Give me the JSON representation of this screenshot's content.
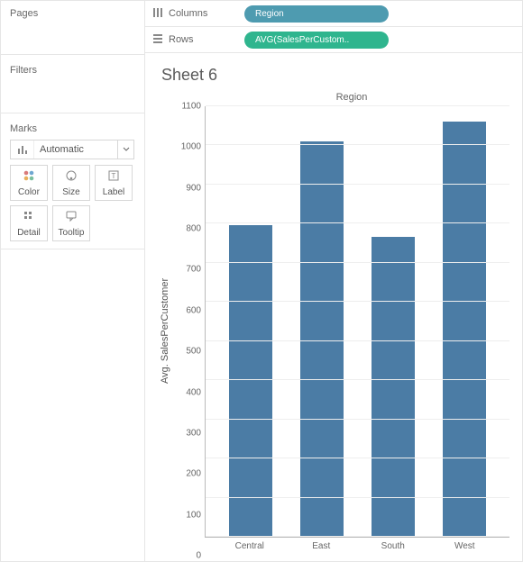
{
  "left": {
    "pages_title": "Pages",
    "filters_title": "Filters",
    "marks_title": "Marks",
    "dropdown_label": "Automatic",
    "mark_buttons": {
      "color": "Color",
      "size": "Size",
      "label": "Label",
      "detail": "Detail",
      "tooltip": "Tooltip"
    }
  },
  "shelves": {
    "columns_label": "Columns",
    "rows_label": "Rows",
    "columns_pill": "Region",
    "rows_pill": "AVG(SalesPerCustom.."
  },
  "sheet": {
    "title": "Sheet 6",
    "subtitle": "Region",
    "ylabel": "Avg. SalesPerCustomer"
  },
  "chart_data": {
    "type": "bar",
    "title": "Region",
    "xlabel": "",
    "ylabel": "Avg. SalesPerCustomer",
    "categories": [
      "Central",
      "East",
      "South",
      "West"
    ],
    "values": [
      797,
      1010,
      767,
      1060
    ],
    "ylim": [
      0,
      1100
    ],
    "yticks": [
      0,
      100,
      200,
      300,
      400,
      500,
      600,
      700,
      800,
      900,
      1000,
      1100
    ]
  },
  "colors": {
    "bar": "#4b7ca5",
    "pill_blue": "#4e9bb0",
    "pill_green": "#2fb58e"
  }
}
